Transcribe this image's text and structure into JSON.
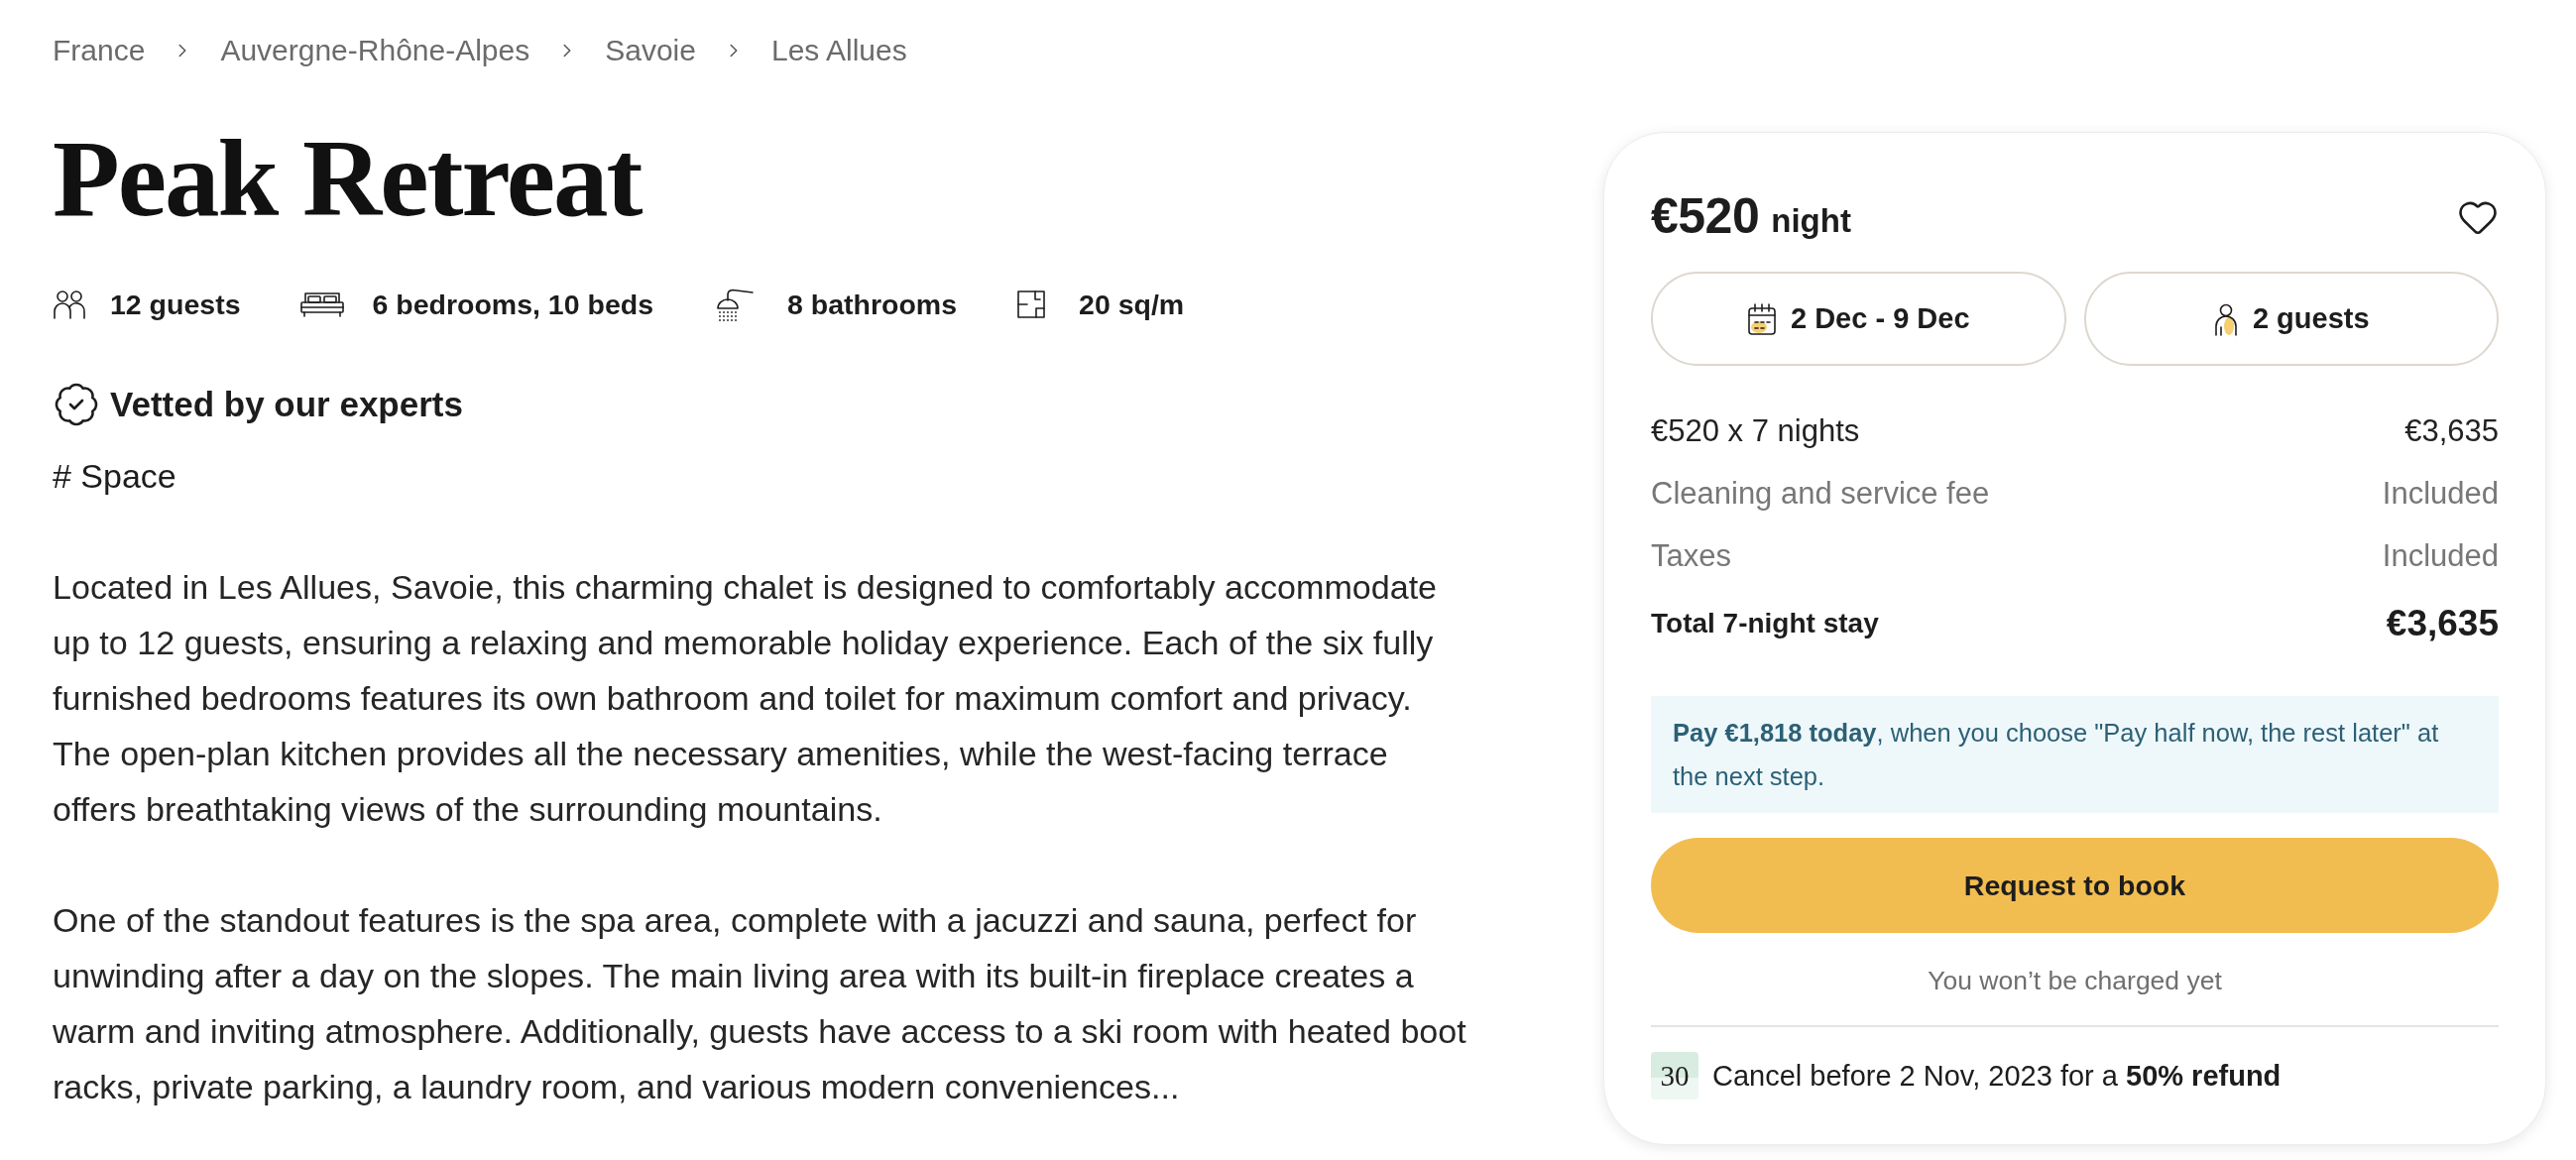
{
  "breadcrumb": [
    "France",
    "Auvergne-Rhône-Alpes",
    "Savoie",
    "Les Allues"
  ],
  "title": "Peak Retreat",
  "features": [
    {
      "kind": "guests",
      "label": "12 guests"
    },
    {
      "kind": "bedrooms",
      "label": "6 bedrooms, 10 beds"
    },
    {
      "kind": "bathrooms",
      "label": "8 bathrooms"
    },
    {
      "kind": "area",
      "label": "20 sq/m"
    }
  ],
  "vetted": "Vetted by our experts",
  "section_heading": "# Space",
  "description": [
    "Located in Les Allues, Savoie, this charming chalet is designed to comfortably accommodate up to 12 guests, ensuring a relaxing and memorable holiday experience. Each of the six fully furnished bedrooms features its own bathroom and toilet for maximum comfort and privacy. The open-plan kitchen provides all the necessary amenities, while the west-facing terrace offers breathtaking views of the surrounding mountains.",
    "One of the standout features is the spa area, complete with a jacuzzi and sauna, perfect for unwinding after a day on the slopes. The main living area with its built-in fireplace creates a warm and inviting atmosphere. Additionally, guests have access to a ski room with heated boot racks, private parking, a laundry room, and various modern conveniences..."
  ],
  "booking": {
    "price": "€520",
    "unit": "night",
    "saved": false,
    "dates": "2 Dec - 9 Dec",
    "guests": "2 guests",
    "lines": [
      {
        "kind": "charge",
        "label": "€520 x 7 nights",
        "value": "€3,635"
      },
      {
        "kind": "fee",
        "label": "Cleaning and service fee",
        "value": "Included"
      },
      {
        "kind": "fee",
        "label": "Taxes",
        "value": "Included"
      },
      {
        "kind": "total",
        "label": "Total 7-night stay",
        "value": "€3,635"
      }
    ],
    "notice": "**Pay €1,818 today**, when you choose \"Pay half now, the rest later\" at the next step.",
    "button": "Request to book",
    "note": "You won’t be charged yet",
    "cancellation": {
      "day": "30",
      "text": "Cancel before 2 Nov, 2023 for a **50% refund**"
    }
  }
}
